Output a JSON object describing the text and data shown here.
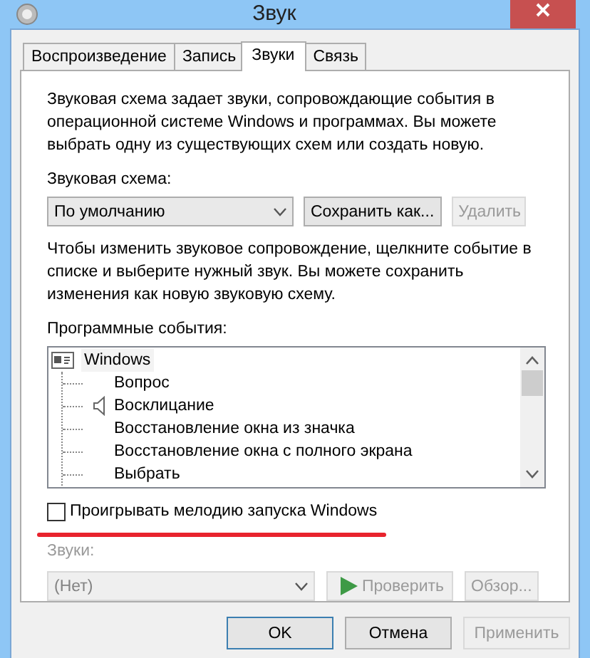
{
  "window": {
    "title": "Звук"
  },
  "tabs": [
    {
      "label": "Воспроизведение",
      "selected": false
    },
    {
      "label": "Запись",
      "selected": false
    },
    {
      "label": "Звуки",
      "selected": true
    },
    {
      "label": "Связь",
      "selected": false
    }
  ],
  "intro": "Звуковая схема задает звуки, сопровождающие события в операционной системе Windows и программах. Вы можете выбрать одну из существующих схем или создать новую.",
  "scheme": {
    "label": "Звуковая схема:",
    "value": "По умолчанию",
    "disabled": false
  },
  "scheme_buttons": [
    {
      "label": "Сохранить как...",
      "disabled": false
    },
    {
      "label": "Удалить",
      "disabled": true
    }
  ],
  "hint": "Чтобы изменить звуковое сопровождение, щелкните событие в списке и выберите нужный звук. Вы можете сохранить изменения как новую звуковую схему.",
  "events": {
    "label": "Программные события:",
    "items": [
      {
        "label": "Windows",
        "children": [
          {
            "label": "Вопрос",
            "sound": false
          },
          {
            "label": "Восклицание",
            "sound": true
          },
          {
            "label": "Восстановление окна из значка",
            "sound": false
          },
          {
            "label": "Восстановление окна с полного экрана",
            "sound": false
          },
          {
            "label": "Выбрать",
            "sound": false
          }
        ]
      }
    ]
  },
  "startup": {
    "label": "Проигрывать мелодию запуска Windows",
    "checked": false
  },
  "sounds": {
    "label": "Звуки:",
    "value": "(Нет)",
    "disabled": true
  },
  "sound_buttons": [
    {
      "kind": "play",
      "label": "Проверить",
      "disabled": true
    },
    {
      "kind": "plain",
      "label": "Обзор...",
      "disabled": true
    }
  ],
  "footer": [
    {
      "label": "OK",
      "default": true,
      "disabled": false
    },
    {
      "label": "Отмена",
      "default": false,
      "disabled": false
    },
    {
      "label": "Применить",
      "default": false,
      "disabled": true
    }
  ]
}
